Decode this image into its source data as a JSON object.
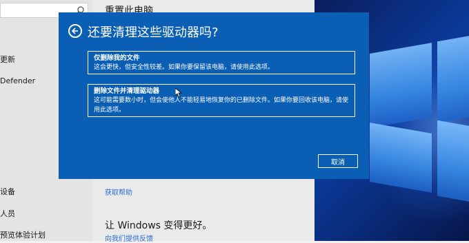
{
  "settings_nav": {
    "items": [
      {
        "label": "更新"
      },
      {
        "label": "Defender"
      },
      {
        "label": "设备"
      },
      {
        "label": "人员"
      },
      {
        "label": "预览体验计划"
      }
    ]
  },
  "settings_main": {
    "heading": "重置此电脑",
    "help_link": "获取帮助",
    "improve_heading": "让 Windows 变得更好。",
    "feedback_link": "向我们提供反馈"
  },
  "dialog": {
    "title": "还要清理这些驱动器吗?",
    "options": [
      {
        "title": "仅删除我的文件",
        "description": "这会更快，但安全性较差。如果你要保留该电脑，请使用此选项。"
      },
      {
        "title": "删除文件并清理驱动器",
        "description": "这可能需要数小时，但会使他人不能轻易地恢复你的已删除文件。如果你要回收该电脑，请使用此选项。"
      }
    ],
    "cancel_label": "取消"
  },
  "colors": {
    "dialog_bg": "#0a5fb4",
    "link": "#2a6fd6"
  }
}
